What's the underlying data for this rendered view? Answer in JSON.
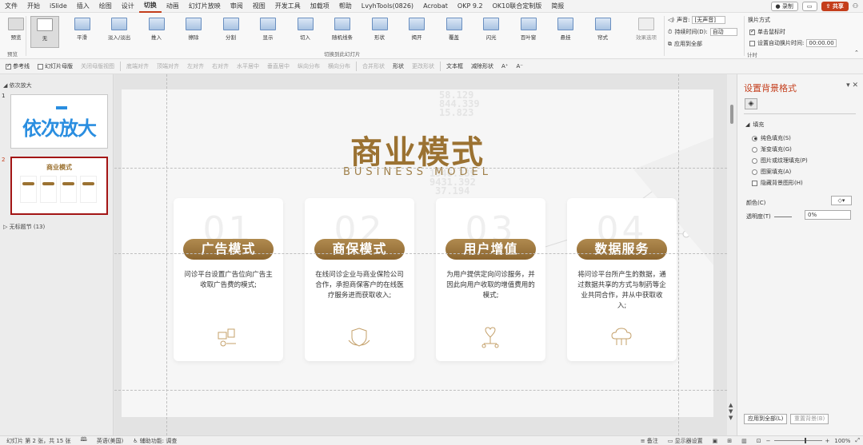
{
  "menu": {
    "items": [
      "文件",
      "开始",
      "iSlide",
      "插入",
      "绘图",
      "设计",
      "切换",
      "动画",
      "幻灯片放映",
      "审阅",
      "视图",
      "开发工具",
      "加载项",
      "帮助",
      "LvyhTools(0826)",
      "Acrobat",
      "OKP 9.2",
      "OK10联合定制版",
      "简报"
    ],
    "active_index": 6,
    "record_label": "录制",
    "share_label": "共享"
  },
  "ribbon": {
    "preview_label": "预览",
    "preview_group": "预览",
    "transitions": [
      "无",
      "平滑",
      "淡入/淡出",
      "推入",
      "擦除",
      "分割",
      "显示",
      "切入",
      "随机线条",
      "形状",
      "揭开",
      "覆盖",
      "闪光",
      "百叶窗",
      "悬挂",
      "帘式"
    ],
    "effect_options_label": "效果选项",
    "group_label": "切换到此幻灯片",
    "sound_label": "声音:",
    "sound_value": "[无声音]",
    "duration_label": "持续时间(D):",
    "duration_value": "自动",
    "apply_all_label": "应用到全部",
    "advance_label": "换片方式",
    "on_click_label": "单击鼠标时",
    "after_label": "设置自动换片时间:",
    "after_value": "00:00.00",
    "timing_group": "计时"
  },
  "format_bar": {
    "items": [
      "参考线",
      "幻灯片母版",
      "关闭母版视图",
      "底端对齐",
      "顶端对齐",
      "左对齐",
      "右对齐",
      "水平居中",
      "垂直居中",
      "纵向分布",
      "横向分布",
      "合并形状",
      "形状",
      "更改形状",
      "文本框",
      "减除形状",
      "A⁺",
      "A⁻"
    ]
  },
  "left_panel": {
    "section1": "依次放大",
    "slide1_num": "1",
    "slide1_title": "依次放大",
    "slide2_num": "2",
    "slide2_title": "商业模式",
    "section2": "无标题节 (13)"
  },
  "slide": {
    "title_cn": "商业模式",
    "title_en": "BUSINESS MODEL",
    "bg_numbers": [
      "58.129",
      "844.339",
      "15.823",
      "1946.339",
      "9431.392",
      "37.194"
    ],
    "cards": [
      {
        "num": "01",
        "badge": "广告模式",
        "desc": "问诊平台设置广告位向广告主收取广告费的模式;"
      },
      {
        "num": "02",
        "badge": "商保模式",
        "desc": "在线问诊企业与商业保险公司合作，承担商保客户的在线医疗服务进而获取收入;"
      },
      {
        "num": "03",
        "badge": "用户增值",
        "desc": "为用户提供定向问诊服务，并因此向用户收取的增值费用的模式;"
      },
      {
        "num": "04",
        "badge": "数据服务",
        "desc": "将问诊平台所产生的数据，通过数据共享的方式与制药等企业共同合作，并从中获取收入;"
      }
    ]
  },
  "right_panel": {
    "title": "设置背景格式",
    "fill_section": "填充",
    "options": [
      "纯色填充(S)",
      "渐变填充(G)",
      "图片或纹理填充(P)",
      "图案填充(A)"
    ],
    "hide_bg": "隐藏背景图形(H)",
    "color_label": "颜色(C)",
    "transparency_label": "透明度(T)",
    "transparency_value": "0%",
    "apply_all": "应用到全部(L)",
    "reset_bg": "重置背景(B)"
  },
  "status": {
    "slide_info": "幻灯片 第 2 张，共 15 张",
    "language": "英语(美国)",
    "accessibility": "辅助功能: 调查",
    "notes": "备注",
    "display": "显示器设置",
    "zoom": "100%"
  },
  "colors": {
    "accent": "#c43e1c",
    "gold": "#9b7232"
  }
}
